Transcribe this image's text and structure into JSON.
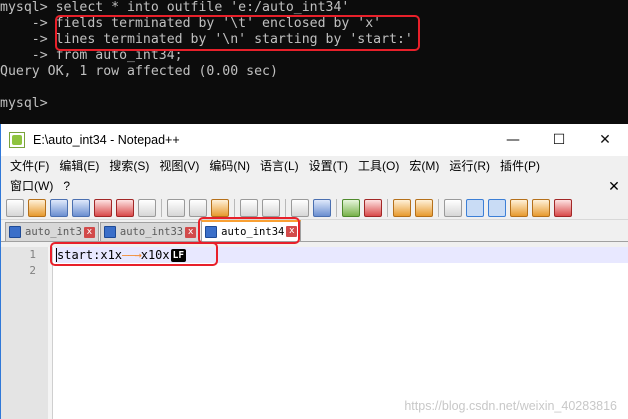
{
  "console": {
    "lines": [
      "mysql> select * into outfile 'e:/auto_int34'",
      "    -> fields terminated by '\\t' enclosed by 'x'",
      "    -> lines terminated by '\\n' starting by 'start:'",
      "    -> from auto_int34;",
      "Query OK, 1 row affected (0.00 sec)",
      "",
      "mysql>"
    ]
  },
  "notepad": {
    "title": "E:\\auto_int34 - Notepad++",
    "window_buttons": {
      "minimize": "—",
      "maximize": "☐",
      "close": "✕"
    },
    "menu_row1": [
      "文件(F)",
      "编辑(E)",
      "搜索(S)",
      "视图(V)",
      "编码(N)",
      "语言(L)",
      "设置(T)",
      "工具(O)",
      "宏(M)",
      "运行(R)",
      "插件(P)"
    ],
    "menu_row2": [
      "窗口(W)",
      "?"
    ],
    "menu_close": "✕",
    "tabs": [
      {
        "label": "auto_int3",
        "close": "x"
      },
      {
        "label": "auto_int33",
        "close": "x"
      },
      {
        "label": "auto_int34",
        "close": "x"
      }
    ],
    "line_numbers": [
      "1",
      "2"
    ],
    "line1": {
      "prefix": "start:x1x",
      "tab_glyph": "——→",
      "suffix": "x10x",
      "eol": "LF"
    },
    "watermark": "https://blog.csdn.net/weixin_40283816",
    "colors": {
      "highlight_box": "#e8202a",
      "active_tab_accent": "#f9a033",
      "line_highlight": "#e8e8ff"
    }
  }
}
